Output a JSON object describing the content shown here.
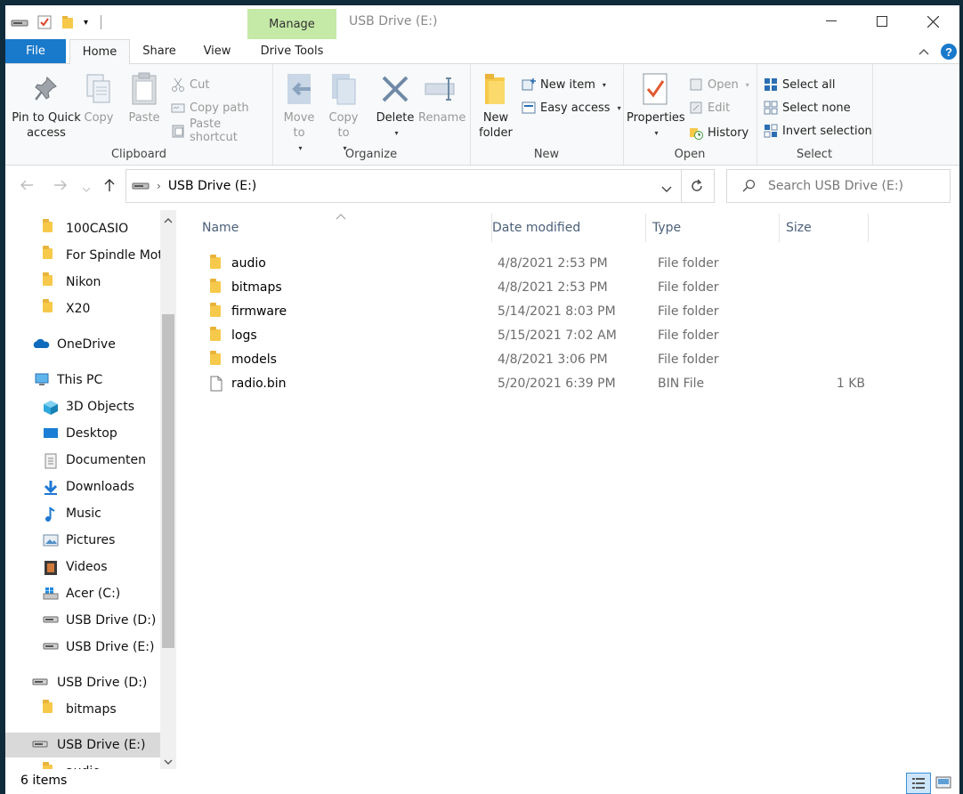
{
  "window": {
    "title": "USB Drive (E:)",
    "manage_label": "Manage"
  },
  "ribbon_tabs": [
    "File",
    "Home",
    "Share",
    "View",
    "Drive Tools"
  ],
  "clipboard": {
    "label": "Clipboard",
    "pin": "Pin to Quick access",
    "copy": "Copy",
    "paste": "Paste",
    "cut": "Cut",
    "copy_path": "Copy path",
    "paste_shortcut": "Paste shortcut"
  },
  "organize": {
    "label": "Organize",
    "move_to": "Move to",
    "copy_to": "Copy to",
    "delete": "Delete",
    "rename": "Rename"
  },
  "new_group": {
    "label": "New",
    "new_folder": "New folder",
    "new_item": "New item",
    "easy_access": "Easy access"
  },
  "open_group": {
    "label": "Open",
    "properties": "Properties",
    "open": "Open",
    "edit": "Edit",
    "history": "History"
  },
  "select_group": {
    "label": "Select",
    "select_all": "Select all",
    "select_none": "Select none",
    "invert": "Invert selection"
  },
  "address": {
    "path": "USB Drive (E:)",
    "search_placeholder": "Search USB Drive (E:)"
  },
  "nav": [
    {
      "label": "100CASIO",
      "icon": "folder-icon"
    },
    {
      "label": "For Spindle Moto",
      "icon": "folder-icon"
    },
    {
      "label": "Nikon",
      "icon": "folder-icon"
    },
    {
      "label": "X20",
      "icon": "folder-icon"
    },
    {
      "label": "OneDrive",
      "icon": "onedrive-icon"
    },
    {
      "label": "This PC",
      "icon": "pc-icon"
    },
    {
      "label": "3D Objects",
      "icon": "cube-icon"
    },
    {
      "label": "Desktop",
      "icon": "desktop-icon"
    },
    {
      "label": "Documenten",
      "icon": "document-icon"
    },
    {
      "label": "Downloads",
      "icon": "download-icon"
    },
    {
      "label": "Music",
      "icon": "music-icon"
    },
    {
      "label": "Pictures",
      "icon": "pictures-icon"
    },
    {
      "label": "Videos",
      "icon": "videos-icon"
    },
    {
      "label": "Acer (C:)",
      "icon": "windows-drive-icon"
    },
    {
      "label": "USB Drive (D:)",
      "icon": "drive-icon"
    },
    {
      "label": "USB Drive (E:)",
      "icon": "drive-icon"
    },
    {
      "label": "USB Drive (D:)",
      "icon": "drive-icon"
    },
    {
      "label": "bitmaps",
      "icon": "folder-icon"
    },
    {
      "label": "USB Drive (E:)",
      "icon": "drive-icon"
    },
    {
      "label": "audio",
      "icon": "folder-icon"
    }
  ],
  "columns": {
    "name": "Name",
    "date": "Date modified",
    "type": "Type",
    "size": "Size"
  },
  "files": [
    {
      "name": "audio",
      "date": "4/8/2021 2:53 PM",
      "type": "File folder",
      "size": "",
      "icon": "folder-icon"
    },
    {
      "name": "bitmaps",
      "date": "4/8/2021 2:53 PM",
      "type": "File folder",
      "size": "",
      "icon": "folder-icon"
    },
    {
      "name": "firmware",
      "date": "5/14/2021 8:03 PM",
      "type": "File folder",
      "size": "",
      "icon": "folder-icon"
    },
    {
      "name": "logs",
      "date": "5/15/2021 7:02 AM",
      "type": "File folder",
      "size": "",
      "icon": "folder-icon"
    },
    {
      "name": "models",
      "date": "4/8/2021 3:06 PM",
      "type": "File folder",
      "size": "",
      "icon": "folder-icon"
    },
    {
      "name": "radio.bin",
      "date": "5/20/2021 6:39 PM",
      "type": "BIN File",
      "size": "1 KB",
      "icon": "file-icon"
    }
  ],
  "status": {
    "items": "6 items"
  },
  "colors": {
    "accent": "#1979ca",
    "manage": "#c5e9a6",
    "folder": "#f7c94b"
  }
}
